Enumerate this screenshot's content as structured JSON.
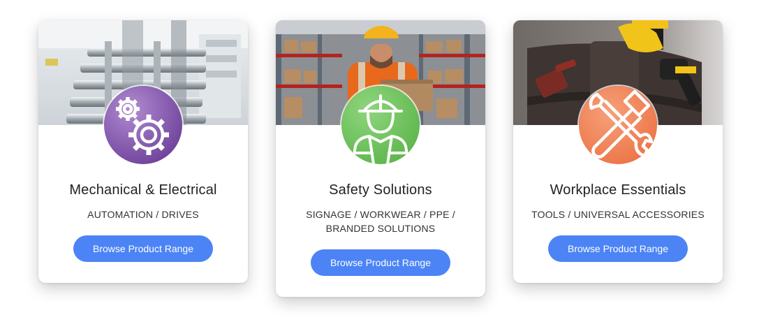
{
  "cards": [
    {
      "title": "Mechanical & Electrical",
      "subtitle": "AUTOMATION / DRIVES",
      "button_label": "Browse Product Range",
      "photo": "gearbox-machinery-photo",
      "icon": "gears-icon",
      "badge_color": "#7b4fa6"
    },
    {
      "title": "Safety Solutions",
      "subtitle": "SIGNAGE / WORKWEAR / PPE / BRANDED SOLUTIONS",
      "button_label": "Browse Product Range",
      "photo": "warehouse-worker-photo",
      "icon": "hardhat-worker-icon",
      "badge_color": "#6cc05a"
    },
    {
      "title": "Workplace Essentials",
      "subtitle": "TOOLS / UNIVERSAL ACCESSORIES",
      "button_label": "Browse Product Range",
      "photo": "tool-belt-drill-photo",
      "icon": "hammer-wrench-icon",
      "badge_color": "#ef7a4c"
    }
  ],
  "colors": {
    "button": "#4c84f6",
    "title_text": "#222222",
    "subtitle_text": "#333333"
  }
}
